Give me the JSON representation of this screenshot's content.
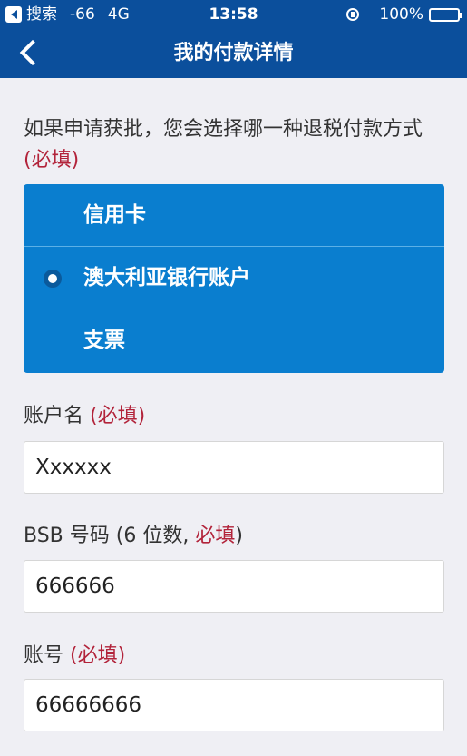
{
  "status_bar": {
    "back_label": "搜索",
    "signal": "-66",
    "network": "4G",
    "time": "13:58",
    "battery": "100%"
  },
  "nav": {
    "title": "我的付款详情"
  },
  "form": {
    "question": "如果申请获批，您会选择哪一种退税付款方式",
    "required": "(必填)",
    "options": [
      {
        "label": "信用卡",
        "selected": false
      },
      {
        "label": "澳大利亚银行账户",
        "selected": true
      },
      {
        "label": "支票",
        "selected": false
      }
    ],
    "account_name": {
      "label": "账户名",
      "required": "(必填)",
      "value": "Xxxxxx"
    },
    "bsb": {
      "label": "BSB 号码 (6 位数,",
      "required": "必填",
      "suffix": ")",
      "value": "666666"
    },
    "account_number": {
      "label": "账号",
      "required": "(必填)",
      "value": "66666666"
    }
  },
  "colors": {
    "header": "#0b4f9c",
    "options_bg": "#0a7ecf",
    "required": "#b2233a",
    "page_bg": "#efeff4"
  }
}
